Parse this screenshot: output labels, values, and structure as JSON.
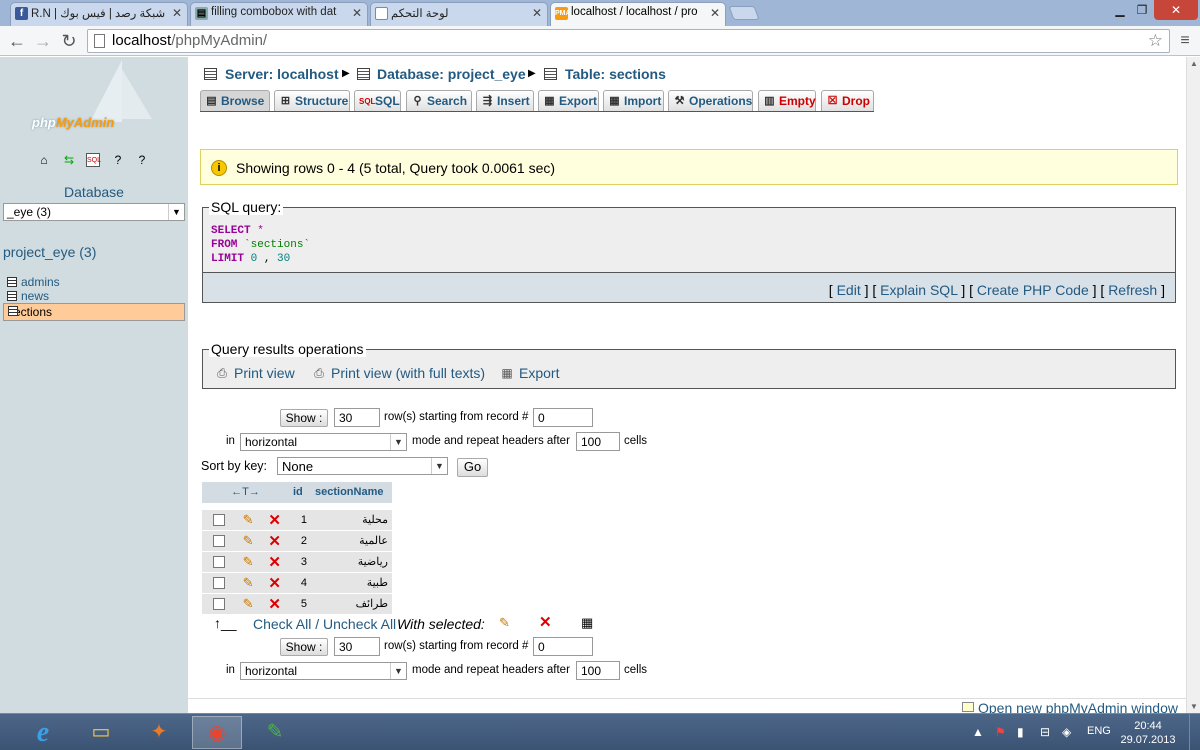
{
  "browser": {
    "tabs": [
      {
        "title": "R.N | شبكة رصد | فيس بوك",
        "icon": "facebook-icon"
      },
      {
        "title": "filling combobox with dat",
        "icon": "document-icon"
      },
      {
        "title": "لوحة التحكم",
        "icon": "document-icon"
      },
      {
        "title": "localhost / localhost / pro",
        "icon": "pma-icon"
      }
    ],
    "url_host": "localhost",
    "url_path": "/phpMyAdmin/"
  },
  "sidebar": {
    "logo_a": "php",
    "logo_b": "MyAdmin",
    "database_label": "Database",
    "database_select": "_eye (3)",
    "db_name": "project_eye (3)",
    "tables": [
      "admins",
      "news",
      "sections"
    ],
    "selected_table": "sections"
  },
  "breadcrumb": {
    "server": "Server: localhost",
    "database": "Database: project_eye",
    "table": "Table: sections"
  },
  "tabs": [
    "Browse",
    "Structure",
    "SQL",
    "Search",
    "Insert",
    "Export",
    "Import",
    "Operations",
    "Empty",
    "Drop"
  ],
  "notice": "Showing rows 0 - 4 (5 total, Query took 0.0061 sec)",
  "sql_query": {
    "legend": "SQL query:",
    "line1_kw": "SELECT",
    "line1_rest": " *",
    "line2_kw": "FROM",
    "line2_rest": "`sections`",
    "line3_kw": "LIMIT",
    "line3_a": "0",
    "line3_sep": " , ",
    "line3_b": "30"
  },
  "sql_actions": {
    "edit": "Edit",
    "explain": "Explain SQL",
    "php": "Create PHP Code",
    "refresh": "Refresh"
  },
  "qro": {
    "legend": "Query results operations",
    "print": "Print view",
    "print_full": "Print view (with full texts)",
    "export": "Export"
  },
  "nav_top": {
    "show_btn": "Show :",
    "rows": "30",
    "rows_label": "row(s) starting from record #",
    "start": "0",
    "in_label": "in",
    "mode": "horizontal",
    "mode_label": "mode and repeat headers after",
    "repeat": "100",
    "cells_label": "cells"
  },
  "sort": {
    "label": "Sort by key:",
    "value": "None",
    "go": "Go"
  },
  "grid": {
    "arrows": "←T→",
    "headers": [
      "id",
      "sectionName"
    ],
    "rows": [
      {
        "id": "1",
        "name": "محلية"
      },
      {
        "id": "2",
        "name": "عالمية"
      },
      {
        "id": "3",
        "name": "رياضية"
      },
      {
        "id": "4",
        "name": "طبية"
      },
      {
        "id": "5",
        "name": "طرائف"
      }
    ]
  },
  "check_all": {
    "link": "Check All / Uncheck All",
    "with_selected": "With selected:"
  },
  "nav_bottom": {
    "show_btn": "Show :",
    "rows": "30",
    "rows_label": "row(s) starting from record #",
    "start": "0",
    "in_label": "in",
    "mode": "horizontal",
    "mode_label": "mode and repeat headers after",
    "repeat": "100",
    "cells_label": "cells"
  },
  "open_new_window": "Open new phpMyAdmin window",
  "taskbar": {
    "lang": "ENG",
    "time": "20:44",
    "date": "29.07.2013"
  }
}
